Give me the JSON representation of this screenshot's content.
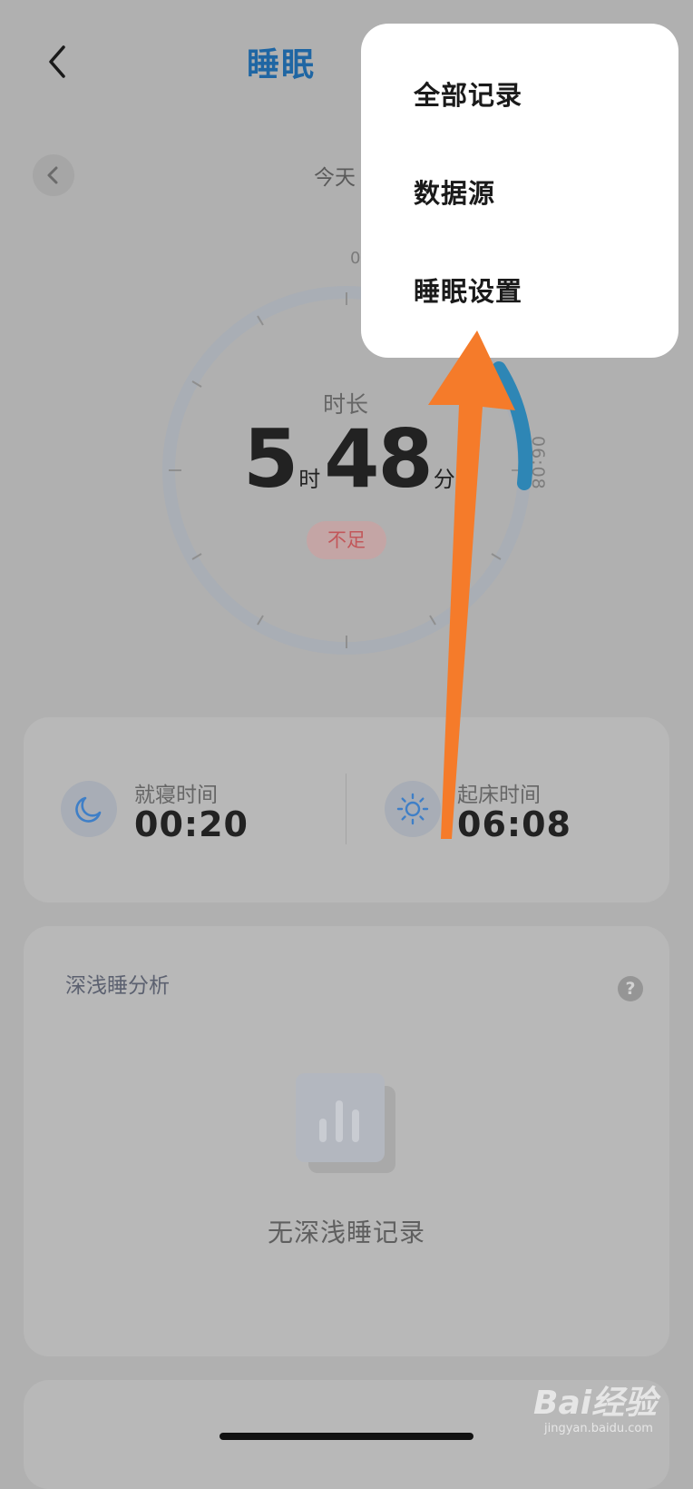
{
  "header": {
    "back_icon": "chevron-left-icon",
    "title": "睡眠"
  },
  "date_nav": {
    "prev_icon": "chevron-left-icon",
    "label": "今天"
  },
  "ring": {
    "top_label": "0",
    "side_label": "06:08",
    "duration_label": "时长",
    "hours": "5",
    "hours_unit": "时",
    "minutes": "48",
    "minutes_unit": "分",
    "status_badge": "不足",
    "track_color": "#a9aeb5",
    "arc_color": "#2e86b5"
  },
  "times": {
    "bedtime": {
      "icon": "moon-icon",
      "title": "就寝时间",
      "value": "00:20"
    },
    "wake": {
      "icon": "sun-icon",
      "title": "起床时间",
      "value": "06:08"
    }
  },
  "analysis": {
    "title": "深浅睡分析",
    "help_icon": "?",
    "empty_icon": "bar-chart-icon",
    "empty_text": "无深浅睡记录"
  },
  "menu": {
    "items": [
      {
        "label": "全部记录"
      },
      {
        "label": "数据源"
      },
      {
        "label": "睡眠设置"
      }
    ]
  },
  "watermark": {
    "text": "Bai经验",
    "sub": "jingyan.baidu.com"
  },
  "colors": {
    "accent": "#1f66a3",
    "overlay_bg": "#b0b0b0",
    "annotation_arrow": "#f57b2a",
    "badge_text": "#c2575a"
  }
}
